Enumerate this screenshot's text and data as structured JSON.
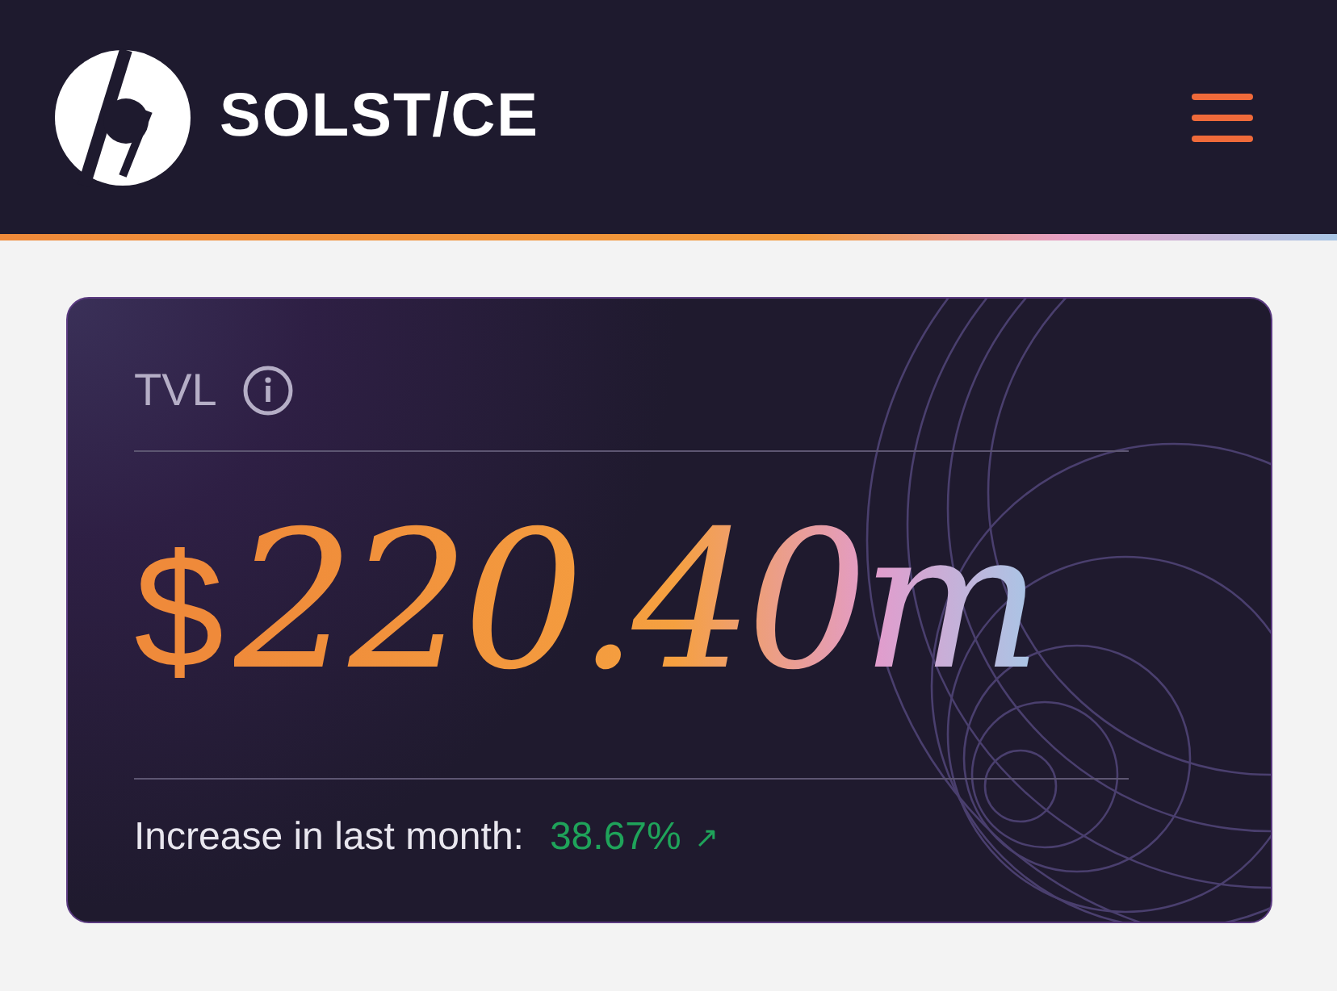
{
  "header": {
    "brand": "SOLST/CE"
  },
  "card": {
    "label": "TVL",
    "currency": "$",
    "amount": "220.40m",
    "change_label": "Increase in last month:",
    "change_value": "38.67%",
    "change_arrow": "↗"
  }
}
